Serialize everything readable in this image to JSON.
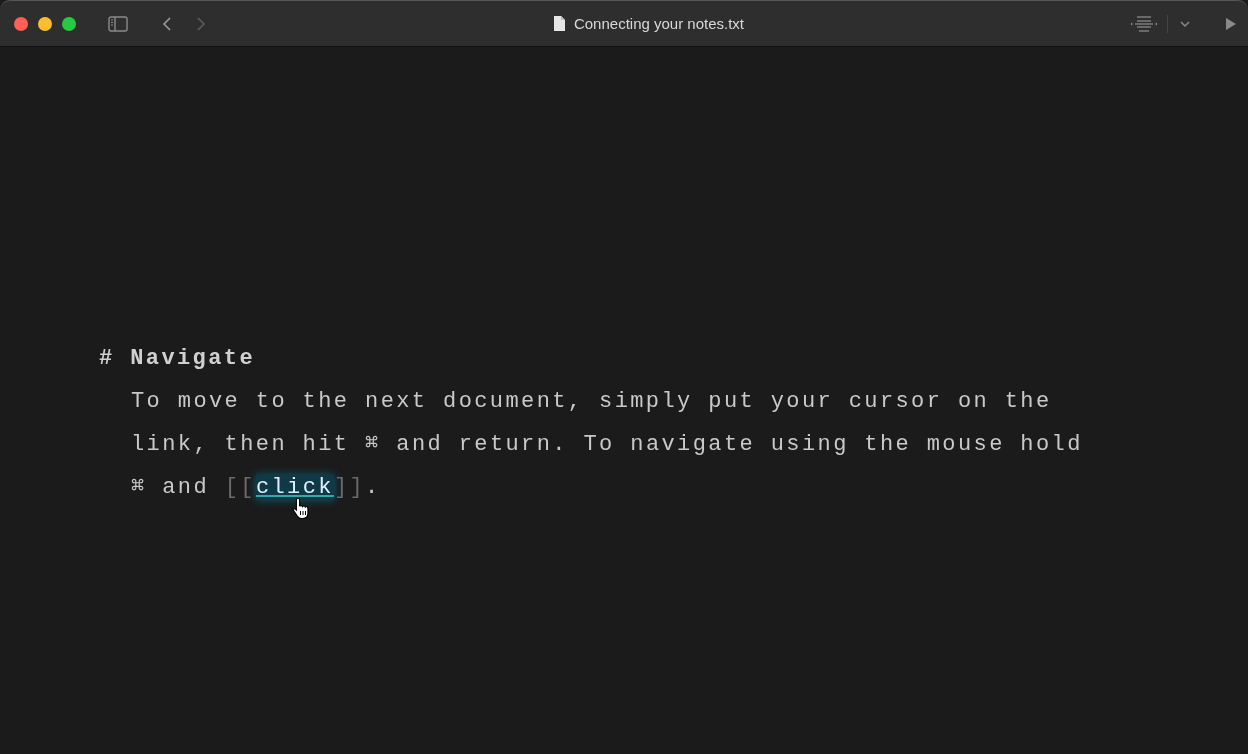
{
  "window": {
    "title": "Connecting your notes.txt"
  },
  "document": {
    "heading_mark": "#",
    "heading": "Navigate",
    "paragraph": {
      "before": "To move to the next document, simply put your cursor on the link, then hit ⌘ and return. To navigate using the mouse hold ⌘ and ",
      "link_open": "[[",
      "link": "click",
      "link_close": "]]",
      "after": ".",
      "link_hovered": true
    }
  }
}
